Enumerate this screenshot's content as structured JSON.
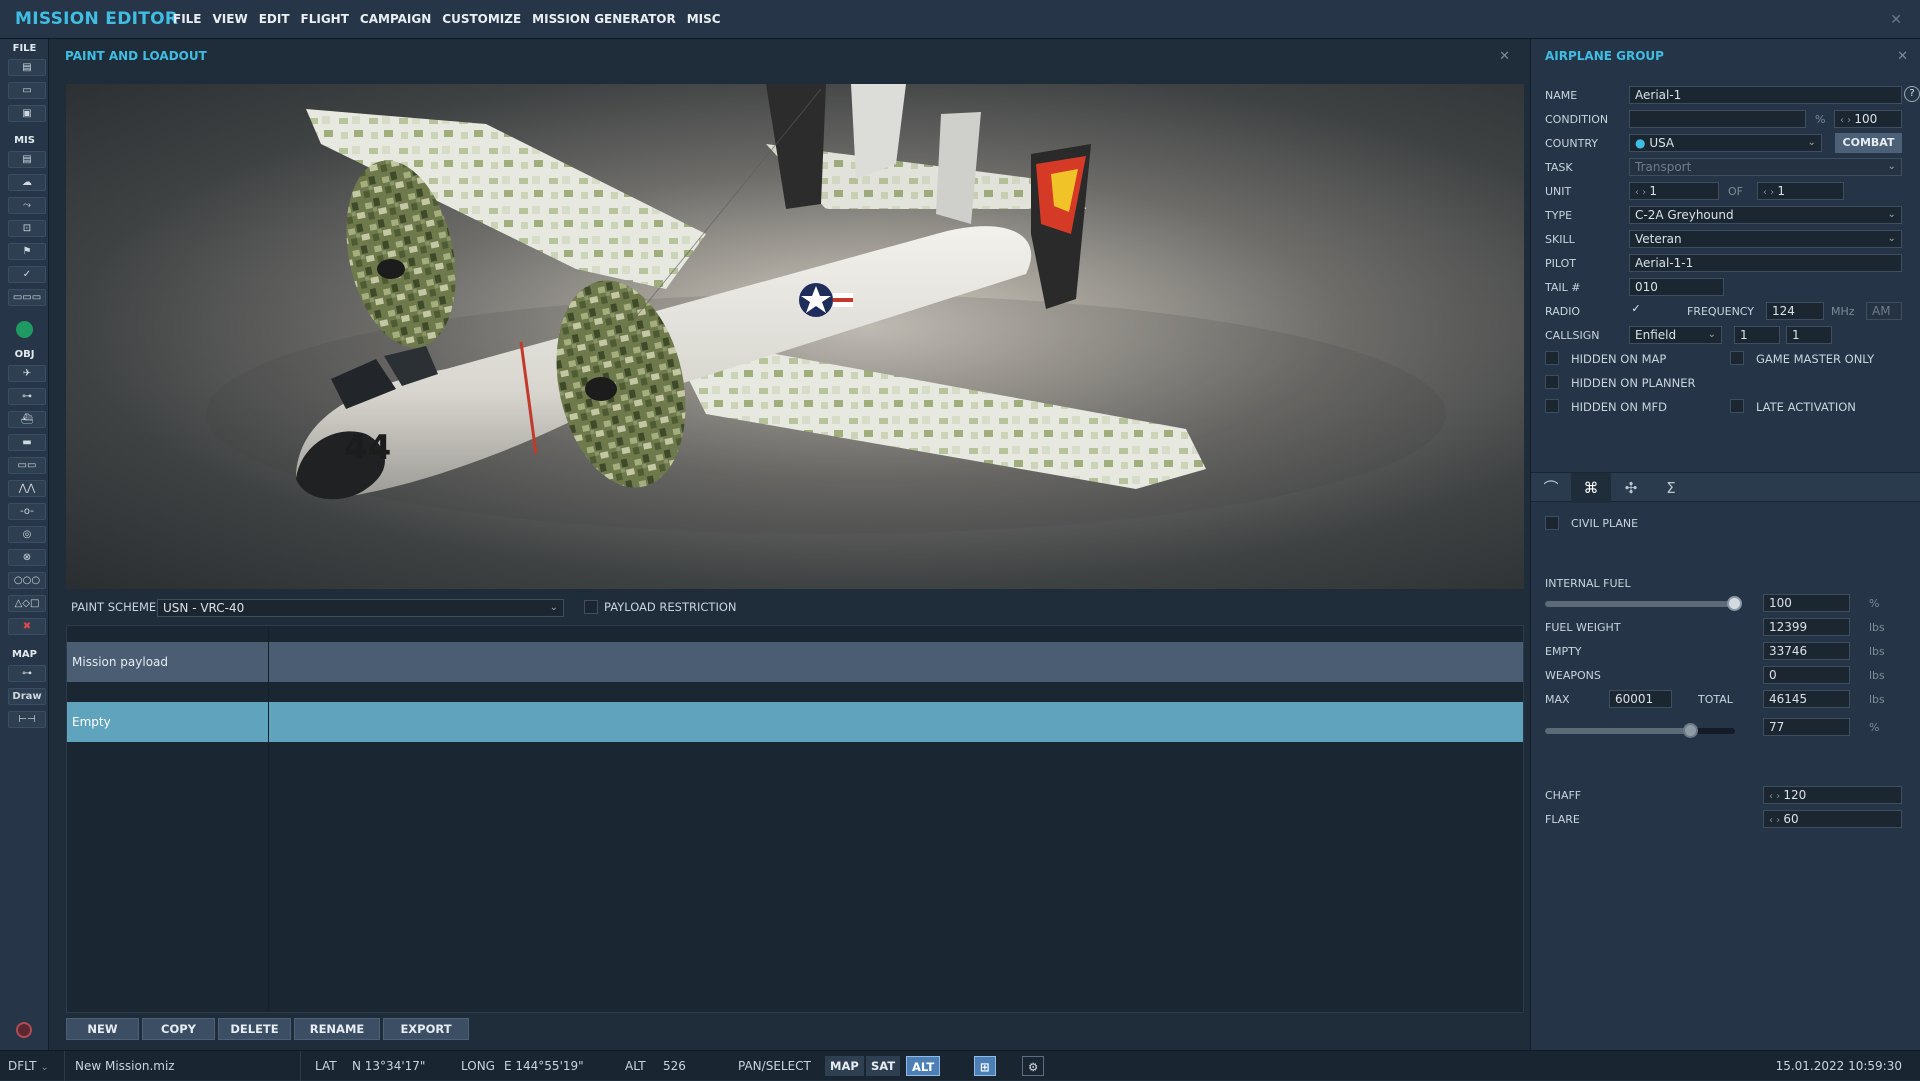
{
  "app": {
    "title": "MISSION EDITOR",
    "menus": [
      "FILE",
      "VIEW",
      "EDIT",
      "FLIGHT",
      "CAMPAIGN",
      "CUSTOMIZE",
      "MISSION GENERATOR",
      "MISC"
    ]
  },
  "toolbar": {
    "sections": [
      "FILE",
      "MIS",
      "OBJ",
      "MAP"
    ],
    "draw_label": "Draw"
  },
  "paint": {
    "title": "PAINT AND LOADOUT",
    "aircraft_number": "44",
    "paint_scheme_label": "PAINT SCHEME",
    "paint_scheme_value": "USN - VRC-40",
    "payload_restriction_label": "PAYLOAD RESTRICTION",
    "payload_rows": [
      {
        "name": "Mission payload"
      },
      {
        "name": "Empty"
      }
    ],
    "buttons": {
      "new": "NEW",
      "copy": "COPY",
      "delete": "DELETE",
      "rename": "RENAME",
      "export": "EXPORT"
    }
  },
  "group": {
    "title": "AIRPLANE GROUP",
    "name_label": "NAME",
    "name_value": "Aerial-1",
    "help": "?",
    "condition_label": "CONDITION",
    "condition_pct": "%",
    "condition_value": "100",
    "country_label": "COUNTRY",
    "country_value": "USA",
    "combat_button": "COMBAT",
    "task_label": "TASK",
    "task_value": "Transport",
    "unit_label": "UNIT",
    "unit_value": "1",
    "unit_of": "OF",
    "unit_total": "1",
    "type_label": "TYPE",
    "type_value": "C-2A Greyhound",
    "skill_label": "SKILL",
    "skill_value": "Veteran",
    "pilot_label": "PILOT",
    "pilot_value": "Aerial-1-1",
    "tail_label": "TAIL #",
    "tail_value": "010",
    "radio_label": "RADIO",
    "frequency_label": "FREQUENCY",
    "frequency_value": "124",
    "frequency_unit": "MHz",
    "modulation": "AM",
    "callsign_label": "CALLSIGN",
    "callsign_value": "Enfield",
    "callsign_num1": "1",
    "callsign_num2": "1",
    "hidden_on_map": "HIDDEN ON MAP",
    "game_master_only": "GAME MASTER ONLY",
    "hidden_on_planner": "HIDDEN ON PLANNER",
    "hidden_on_mfd": "HIDDEN ON MFD",
    "late_activation": "LATE ACTIVATION",
    "tabs": [
      "route-icon",
      "payload-icon",
      "properties-icon",
      "summary-icon"
    ],
    "civil_plane": "CIVIL PLANE",
    "internal_fuel_label": "INTERNAL FUEL",
    "internal_fuel_value": "100",
    "internal_fuel_unit": "%",
    "internal_fuel_fraction": 1.0,
    "fuel_weight_label": "FUEL WEIGHT",
    "fuel_weight_value": "12399",
    "empty_label": "EMPTY",
    "empty_value": "33746",
    "weapons_label": "WEAPONS",
    "weapons_value": "0",
    "max_label": "MAX",
    "max_value": "60001",
    "total_label": "TOTAL",
    "total_value": "46145",
    "total_pct_value": "77",
    "total_pct_fraction": 0.77,
    "lbs": "lbs",
    "pct": "%",
    "chaff_label": "CHAFF",
    "chaff_value": "120",
    "flare_label": "FLARE",
    "flare_value": "60"
  },
  "status": {
    "profile": "DFLT",
    "file": "New Mission.miz",
    "lat_label": "LAT",
    "lat_value": "N 13°34'17\"",
    "long_label": "LONG",
    "long_value": "E 144°55'19\"",
    "alt_label": "ALT",
    "alt_value": "526",
    "mode": "PAN/SELECT",
    "map_btn": "MAP",
    "sat_btn": "SAT",
    "alt_btn": "ALT",
    "datetime": "15.01.2022 10:59:30"
  },
  "colors": {
    "accent": "#3fbde3",
    "selected_row": "#5fa3bd",
    "payload_row": "#4a5d73"
  }
}
